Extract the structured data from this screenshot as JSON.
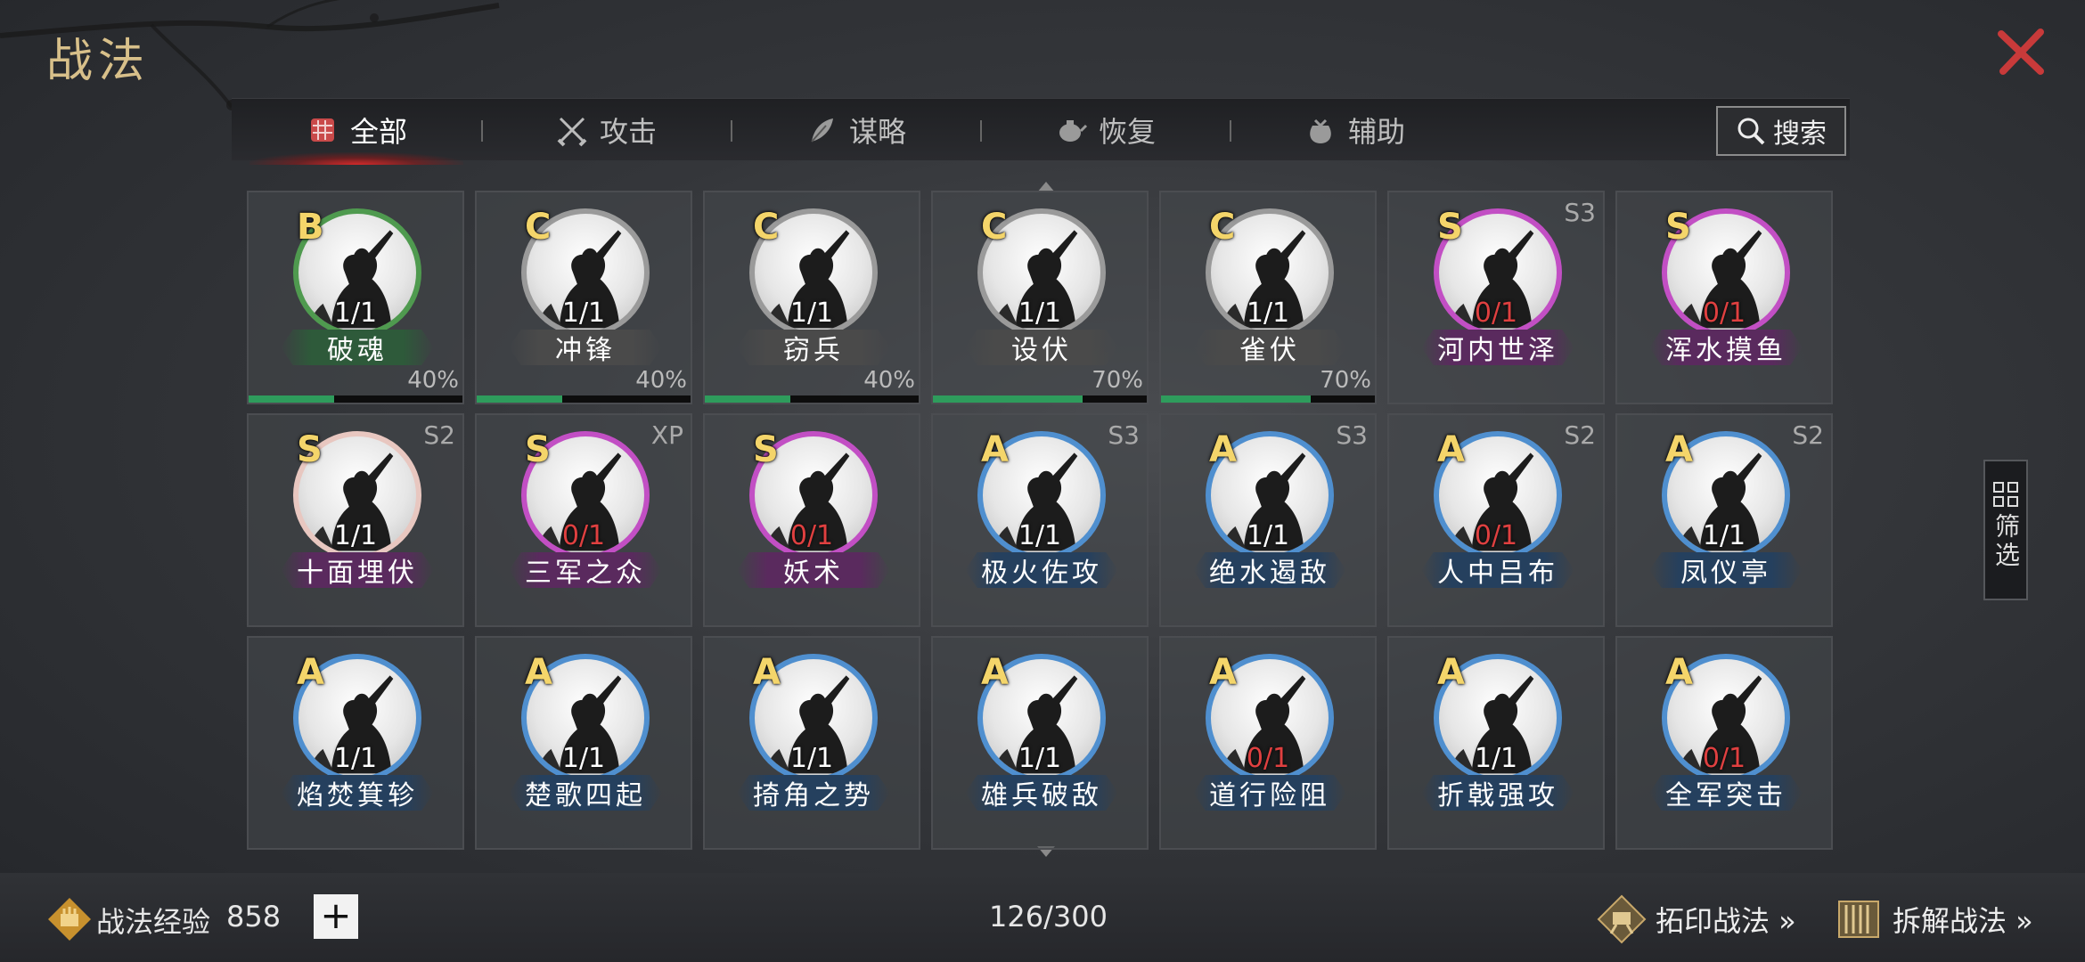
{
  "page_title": "战法",
  "tabs": [
    {
      "label": "全部",
      "active": true,
      "icon": "bundle-icon"
    },
    {
      "label": "攻击",
      "active": false,
      "icon": "crossed-swords-icon"
    },
    {
      "label": "谋略",
      "active": false,
      "icon": "feather-icon"
    },
    {
      "label": "恢复",
      "active": false,
      "icon": "teapot-icon"
    },
    {
      "label": "辅助",
      "active": false,
      "icon": "pouch-icon"
    }
  ],
  "search_label": "搜索",
  "filter_label": "筛选",
  "cards": [
    {
      "grade": "B",
      "count": "1/1",
      "count_red": false,
      "name": "破魂",
      "ring": "#4f9a4f",
      "plate": "#2e5a3a",
      "season": "",
      "percent": "40%",
      "progress": 0.4
    },
    {
      "grade": "C",
      "count": "1/1",
      "count_red": false,
      "name": "冲锋",
      "ring": "#9a9a9a",
      "plate": "#4a4a4a",
      "season": "",
      "percent": "40%",
      "progress": 0.4
    },
    {
      "grade": "C",
      "count": "1/1",
      "count_red": false,
      "name": "窃兵",
      "ring": "#9a9a9a",
      "plate": "#4a4a4a",
      "season": "",
      "percent": "40%",
      "progress": 0.4
    },
    {
      "grade": "C",
      "count": "1/1",
      "count_red": false,
      "name": "设伏",
      "ring": "#9a9a9a",
      "plate": "#4a4a4a",
      "season": "",
      "percent": "70%",
      "progress": 0.7
    },
    {
      "grade": "C",
      "count": "1/1",
      "count_red": false,
      "name": "雀伏",
      "ring": "#9a9a9a",
      "plate": "#4a4a4a",
      "season": "",
      "percent": "70%",
      "progress": 0.7
    },
    {
      "grade": "S",
      "count": "0/1",
      "count_red": true,
      "name": "河内世泽",
      "ring": "#c24fc4",
      "plate": "#5a2a5e",
      "season": "S3",
      "percent": "",
      "progress": null
    },
    {
      "grade": "S",
      "count": "0/1",
      "count_red": true,
      "name": "浑水摸鱼",
      "ring": "#c24fc4",
      "plate": "#5a2a5e",
      "season": "",
      "percent": "",
      "progress": null
    },
    {
      "grade": "S",
      "count": "1/1",
      "count_red": false,
      "name": "十面埋伏",
      "ring": "#e8c7c0",
      "plate": "#5a2a5e",
      "season": "S2",
      "percent": "",
      "progress": null
    },
    {
      "grade": "S",
      "count": "0/1",
      "count_red": true,
      "name": "三军之众",
      "ring": "#c24fc4",
      "plate": "#5a2a5e",
      "season": "XP",
      "percent": "",
      "progress": null
    },
    {
      "grade": "S",
      "count": "0/1",
      "count_red": true,
      "name": "妖术",
      "ring": "#c24fc4",
      "plate": "#5a2a5e",
      "season": "",
      "percent": "",
      "progress": null
    },
    {
      "grade": "A",
      "count": "1/1",
      "count_red": false,
      "name": "极火佐攻",
      "ring": "#4f8fcf",
      "plate": "#25405e",
      "season": "S3",
      "percent": "",
      "progress": null
    },
    {
      "grade": "A",
      "count": "1/1",
      "count_red": false,
      "name": "绝水遏敌",
      "ring": "#4f8fcf",
      "plate": "#25405e",
      "season": "S3",
      "percent": "",
      "progress": null
    },
    {
      "grade": "A",
      "count": "0/1",
      "count_red": true,
      "name": "人中吕布",
      "ring": "#4f8fcf",
      "plate": "#25405e",
      "season": "S2",
      "percent": "",
      "progress": null
    },
    {
      "grade": "A",
      "count": "1/1",
      "count_red": false,
      "name": "凤仪亭",
      "ring": "#4f8fcf",
      "plate": "#25405e",
      "season": "S2",
      "percent": "",
      "progress": null
    },
    {
      "grade": "A",
      "count": "1/1",
      "count_red": false,
      "name": "焰焚箕轸",
      "ring": "#4f8fcf",
      "plate": "#25405e",
      "season": "",
      "percent": "",
      "progress": null
    },
    {
      "grade": "A",
      "count": "1/1",
      "count_red": false,
      "name": "楚歌四起",
      "ring": "#4f8fcf",
      "plate": "#25405e",
      "season": "",
      "percent": "",
      "progress": null
    },
    {
      "grade": "A",
      "count": "1/1",
      "count_red": false,
      "name": "掎角之势",
      "ring": "#4f8fcf",
      "plate": "#25405e",
      "season": "",
      "percent": "",
      "progress": null
    },
    {
      "grade": "A",
      "count": "1/1",
      "count_red": false,
      "name": "雄兵破敌",
      "ring": "#4f8fcf",
      "plate": "#25405e",
      "season": "",
      "percent": "",
      "progress": null
    },
    {
      "grade": "A",
      "count": "0/1",
      "count_red": true,
      "name": "道行险阻",
      "ring": "#4f8fcf",
      "plate": "#25405e",
      "season": "",
      "percent": "",
      "progress": null
    },
    {
      "grade": "A",
      "count": "1/1",
      "count_red": false,
      "name": "折戟强攻",
      "ring": "#4f8fcf",
      "plate": "#25405e",
      "season": "",
      "percent": "",
      "progress": null
    },
    {
      "grade": "A",
      "count": "0/1",
      "count_red": true,
      "name": "全军突击",
      "ring": "#4f8fcf",
      "plate": "#25405e",
      "season": "",
      "percent": "",
      "progress": null
    }
  ],
  "bottom": {
    "exp_label": "战法经验",
    "exp_value": "858",
    "plus_label": "+",
    "capacity": "126/300",
    "imprint_label": "拓印战法 »",
    "decompose_label": "拆解战法 »"
  },
  "colors": {
    "title_gold": "#d8c08a",
    "close_red": "#c83a3a",
    "progress_green": "#2e9c5c",
    "grade_yellow": "#f4d56a",
    "count_red": "#e04040"
  }
}
